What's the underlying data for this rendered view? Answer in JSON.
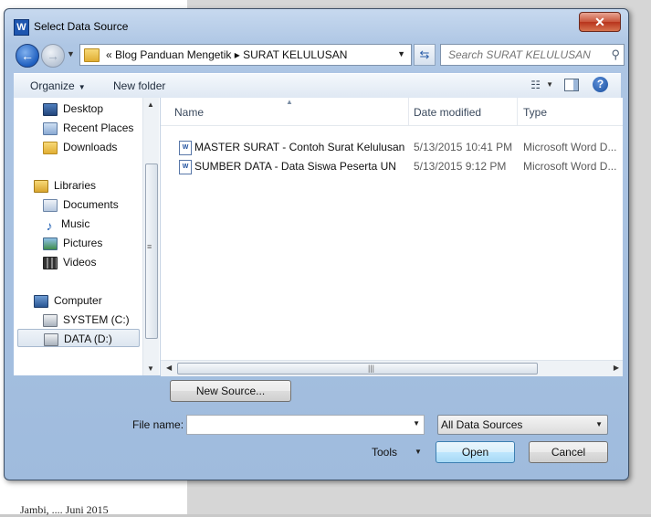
{
  "background": {
    "doc_text": "Jambi, .... Juni 2015"
  },
  "window": {
    "title": "Select Data Source",
    "app_icon": "W",
    "close_symbol": "✕"
  },
  "address": {
    "path_text": "«  Blog Panduan Mengetik  ▸  SURAT KELULUSAN",
    "search_placeholder": "Search SURAT KELULUSAN"
  },
  "toolbar": {
    "organize_label": "Organize",
    "new_folder_label": "New folder",
    "help_symbol": "?"
  },
  "nav": {
    "items": [
      {
        "label": "Desktop",
        "icon": "desktop-icon"
      },
      {
        "label": "Recent Places",
        "icon": "recent-places-icon"
      },
      {
        "label": "Downloads",
        "icon": "downloads-folder-icon"
      },
      {
        "label": "Libraries",
        "icon": "libraries-icon"
      },
      {
        "label": "Documents",
        "icon": "documents-icon"
      },
      {
        "label": "Music",
        "icon": "music-icon"
      },
      {
        "label": "Pictures",
        "icon": "pictures-icon"
      },
      {
        "label": "Videos",
        "icon": "videos-icon"
      },
      {
        "label": "Computer",
        "icon": "computer-icon"
      },
      {
        "label": "SYSTEM (C:)",
        "icon": "drive-icon"
      },
      {
        "label": "DATA (D:)",
        "icon": "drive-icon",
        "selected": true
      }
    ]
  },
  "files": {
    "columns": {
      "name": "Name",
      "date_modified": "Date modified",
      "type": "Type"
    },
    "rows": [
      {
        "name": "MASTER SURAT - Contoh Surat Kelulusan",
        "date": "5/13/2015 10:41 PM",
        "type": "Microsoft Word D..."
      },
      {
        "name": "SUMBER DATA - Data Siswa Peserta UN",
        "date": "5/13/2015 9:12 PM",
        "type": "Microsoft Word D..."
      }
    ]
  },
  "footer": {
    "new_source_label": "New Source...",
    "file_name_label": "File name:",
    "file_name_value": "",
    "filter_value": "All Data Sources",
    "tools_label": "Tools",
    "open_label": "Open",
    "cancel_label": "Cancel"
  }
}
